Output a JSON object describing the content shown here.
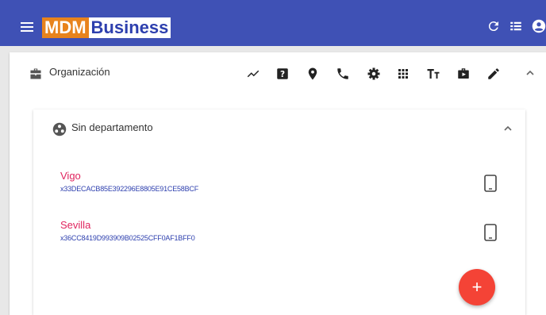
{
  "header": {
    "logo_part1": "MDM",
    "logo_part2": "Business",
    "colors": {
      "bar": "#3f51b5",
      "logo_accent": "#e8831c"
    }
  },
  "organization": {
    "label": "Organización",
    "actions": [
      "chart-icon",
      "help-icon",
      "location-icon",
      "phone-icon",
      "settings-icon",
      "apps-icon",
      "text-size-icon",
      "work-icon",
      "edit-icon"
    ]
  },
  "department": {
    "label": "Sin departamento",
    "devices": [
      {
        "name": "Vigo",
        "id": "x33DECACB85E392296E8805E91CE58BCF"
      },
      {
        "name": "Sevilla",
        "id": "x36CC8419D993909B02525CFF0AF1BFF0"
      }
    ]
  },
  "fab": {
    "label": "+"
  }
}
